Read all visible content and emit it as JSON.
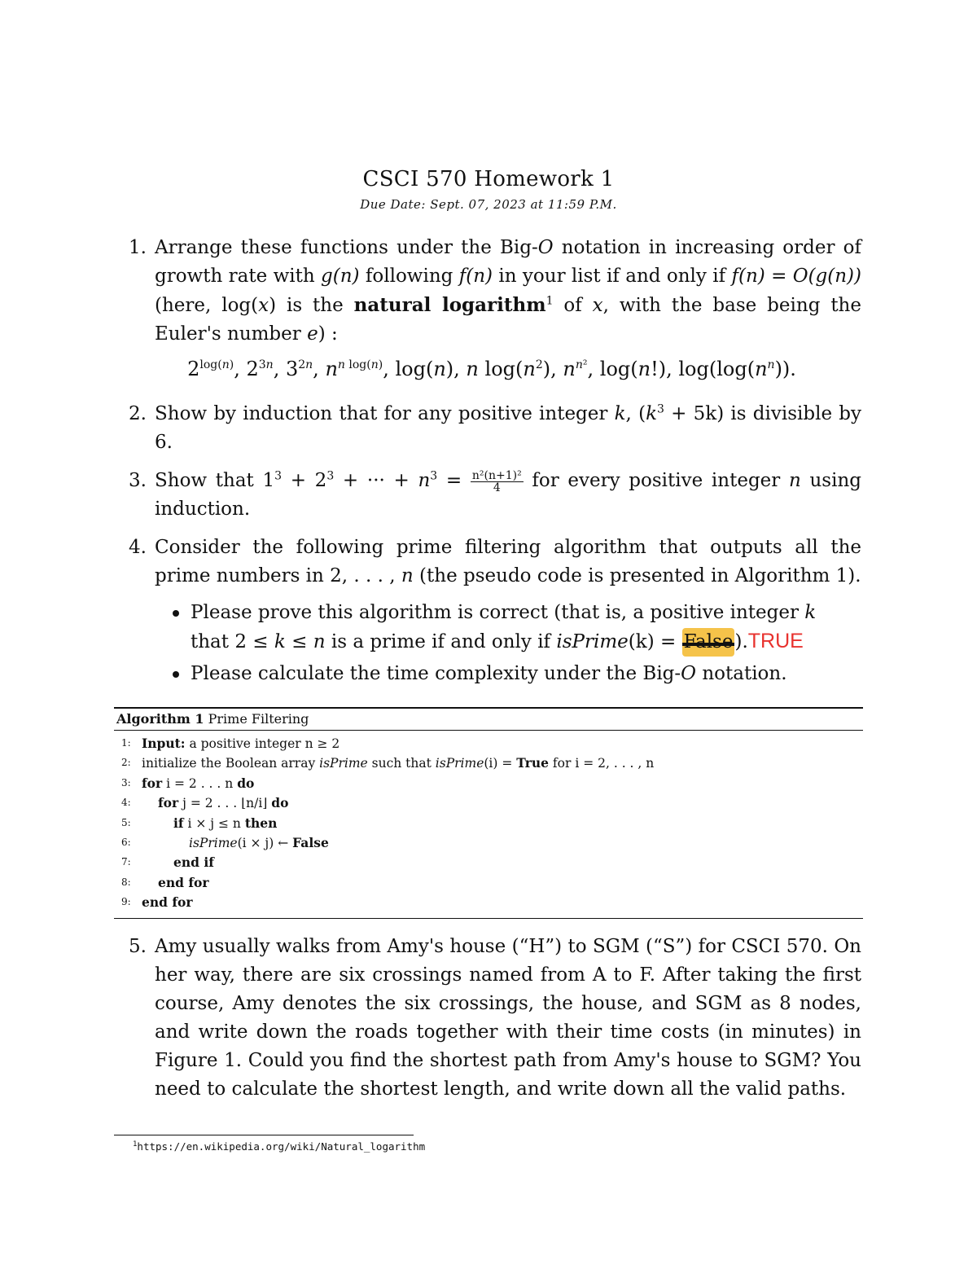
{
  "header": {
    "title": "CSCI 570 Homework 1",
    "due_date": "Due Date: Sept. 07, 2023 at 11:59 P.M."
  },
  "questions": [
    {
      "number": "1.",
      "text_part1": "Arrange these functions under the Big-",
      "O": "O",
      "text_part2": " notation in increasing order of growth rate with ",
      "g_n": "g(n)",
      "text_part3": " following ",
      "f_n": "f(n)",
      "text_part4": " in your list if and only if ",
      "f_n2": "f(n)",
      "text_part5": " = ",
      "O_g_n": "O(g(n))",
      "text_part6": " (here, log(",
      "x": "x",
      "text_part7": ") is the ",
      "bold_term": "natural logarithm",
      "footnote_ref": "1",
      "text_part8": " of ",
      "x2": "x",
      "text_part9": ", with the base being the Euler's number ",
      "e": "e",
      "text_part10": ") :",
      "functions": [
        "2^log(n)",
        "2^3n",
        "3^2n",
        "n^(n log(n))",
        "log(n)",
        "n log(n^2)",
        "n^(n^2)",
        "log(n!)",
        "log(log(n^n))"
      ]
    },
    {
      "number": "2.",
      "text_part1": "Show by induction that for any positive integer ",
      "k": "k",
      "text_part2": ", (",
      "expr": "k",
      "expr_exp": "3",
      "expr_rest": " + 5k",
      "text_part3": ") is divisible by 6."
    },
    {
      "number": "3.",
      "text_part1": "Show that 1",
      "exp": "3",
      "sum_mid": " + 2",
      "sum_end": " + ··· + ",
      "n": "n",
      "eq": " = ",
      "frac_num": "n²(n+1)²",
      "frac_den": "4",
      "text_part2": " for every positive integer ",
      "text_part3": " using induction."
    },
    {
      "number": "4.",
      "text_part1": "Consider the following prime filtering algorithm that outputs all the prime numbers in 2, . . . , ",
      "n": "n",
      "text_part2": " (the pseudo code is presented in Algorithm 1).",
      "bullets": [
        {
          "text_part1": "Please prove this algorithm is correct (that is, a positive integer ",
          "k": "k",
          "text_part2": " that 2 ≤ ",
          "text_part3": " ≤ ",
          "text_part4": " is a prime if and only if ",
          "fn": "isPrime",
          "arg": "(k) = ",
          "struck_value": "False",
          "close": ").",
          "annotation": "TRUE",
          "annotation_color": "#e8322e",
          "highlight_color": "#f5c34a"
        },
        {
          "text": "Please calculate the time complexity under the Big-",
          "O": "O",
          "text_end": " notation."
        }
      ]
    },
    {
      "number": "5.",
      "text": "Amy usually walks from Amy's house (“H”) to SGM (“S”) for CSCI 570. On her way, there are six crossings named from A to F. After taking the first course, Amy denotes the six crossings, the house, and SGM as 8 nodes, and write down the roads together with their time costs (in minutes) in Figure 1. Could you find the shortest path from Amy's house to SGM? You need to calculate the shortest length, and write down all the valid paths."
    }
  ],
  "algorithm": {
    "label": "Algorithm 1",
    "title": "Prime Filtering",
    "lines": [
      {
        "num": "1:",
        "kw": "Input:",
        "text": " a positive integer n ≥ 2"
      },
      {
        "num": "2:",
        "text": "initialize the Boolean array ",
        "it1": "isPrime",
        "mid": " such that ",
        "it2": "isPrime",
        "mid2": "(i) = ",
        "kw": "True",
        "end": " for i = 2, . . . , n"
      },
      {
        "num": "3:",
        "kw": "for",
        "text": " i = 2 . . . n ",
        "kw2": "do"
      },
      {
        "num": "4:",
        "kw": "for",
        "text": " j = 2 . . . ⌊n/i⌋ ",
        "kw2": "do"
      },
      {
        "num": "5:",
        "kw": "if",
        "text": " i × j ≤ n ",
        "kw2": "then"
      },
      {
        "num": "6:",
        "it1": "isPrime",
        "text": "(i × j) ← ",
        "kw": "False"
      },
      {
        "num": "7:",
        "kw": "end if"
      },
      {
        "num": "8:",
        "kw": "end for"
      },
      {
        "num": "9:",
        "kw": "end for"
      }
    ]
  },
  "footnote": {
    "mark": "1",
    "url": "https://en.wikipedia.org/wiki/Natural_logarithm"
  }
}
